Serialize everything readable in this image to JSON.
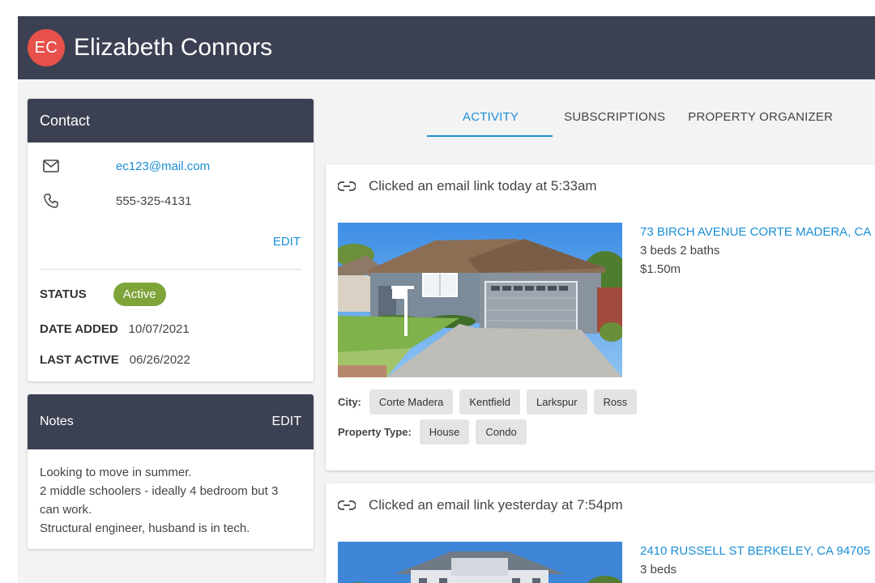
{
  "header": {
    "avatar_initials": "EC",
    "name": "Elizabeth Connors"
  },
  "contact": {
    "title": "Contact",
    "email": "ec123@mail.com",
    "phone": "555-325-4131",
    "edit_label": "EDIT",
    "status_label": "STATUS",
    "status_value": "Active",
    "date_added_label": "DATE ADDED",
    "date_added_value": "10/07/2021",
    "last_active_label": "LAST ACTIVE",
    "last_active_value": "06/26/2022",
    "icons": {
      "email": "mail-icon",
      "phone": "phone-icon"
    }
  },
  "notes": {
    "title": "Notes",
    "edit_label": "EDIT",
    "lines": [
      "Looking to move in summer.",
      "2 middle schoolers - ideally 4 bedroom but 3",
      "can work.",
      "Structural engineer, husband is in tech."
    ]
  },
  "tabs": [
    {
      "label": "ACTIVITY",
      "active": true
    },
    {
      "label": "SUBSCRIPTIONS",
      "active": false
    },
    {
      "label": "PROPERTY ORGANIZER",
      "active": false
    }
  ],
  "activities": [
    {
      "text": "Clicked an email link today at 5:33am",
      "icon": "link-icon",
      "address": "73 BIRCH AVENUE CORTE MADERA, CA",
      "details": "3 beds  2 baths",
      "price": "$1.50m",
      "filters": {
        "city_label": "City:",
        "cities": [
          "Corte Madera",
          "Kentfield",
          "Larkspur",
          "Ross"
        ],
        "type_label": "Property Type:",
        "types": [
          "House",
          "Condo"
        ]
      }
    },
    {
      "text": "Clicked an email link yesterday at 7:54pm",
      "icon": "link-icon",
      "address": "2410 RUSSELL ST BERKELEY, CA 94705",
      "details": "3 beds"
    }
  ],
  "colors": {
    "header_bg": "#3b4152",
    "accent": "#1a8fd6",
    "status_active": "#7ea43a",
    "avatar_bg": "#e8514b"
  }
}
